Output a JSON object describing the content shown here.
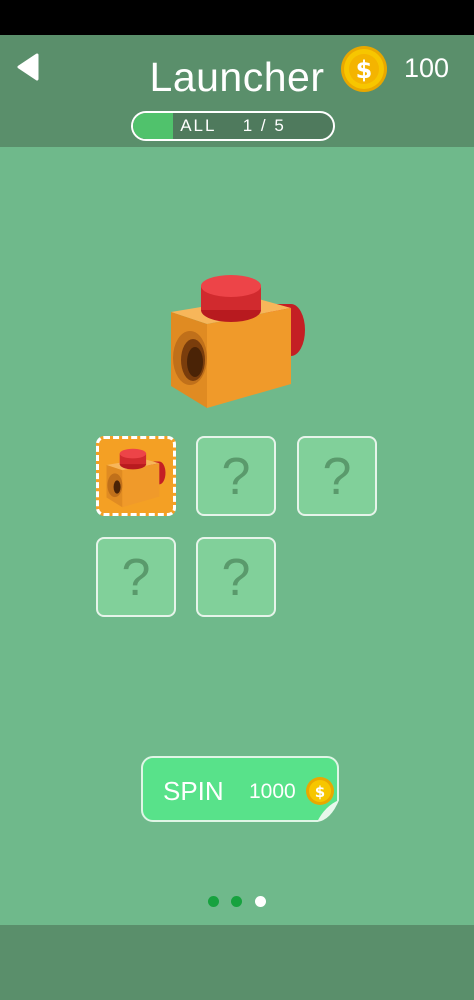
{
  "header": {
    "title": "Launcher",
    "coins": "100",
    "back_icon": "back-arrow-icon",
    "coin_icon": "dollar-coin-icon"
  },
  "progress": {
    "label": "ALL",
    "text": "ALL    1 / 5",
    "current": "1",
    "total": "5",
    "fraction": 0.2
  },
  "hero": {
    "icon": "orange-cube-launcher-item"
  },
  "grid": {
    "items": [
      {
        "state": "unlocked",
        "label": ""
      },
      {
        "state": "locked",
        "label": "?"
      },
      {
        "state": "locked",
        "label": "?"
      },
      {
        "state": "locked",
        "label": "?"
      },
      {
        "state": "locked",
        "label": "?"
      }
    ]
  },
  "spin": {
    "label": "SPIN",
    "cost": "1000",
    "coin_icon": "dollar-coin-icon"
  },
  "pager": {
    "count": 3,
    "active_index": 2
  },
  "colors": {
    "background": "#6fb98b",
    "header": "#5a8f6b",
    "progress_fill": "#50c26c",
    "selected_tile": "#f4a024",
    "locked_tile": "#81d09a",
    "spin_button": "#58e28a",
    "coin": "#f7c600",
    "dot_inactive": "#17a23f",
    "dot_active": "#ffffff"
  }
}
